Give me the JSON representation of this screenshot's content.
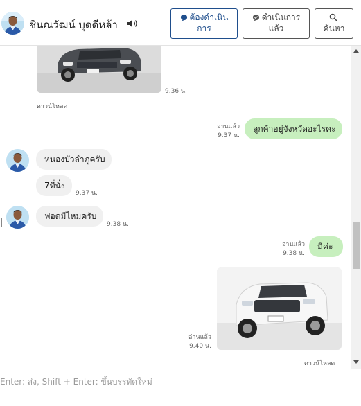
{
  "header": {
    "contact_name": "ชินณวัฒน์ บุดดีหล้า",
    "buttons": {
      "pending": {
        "line1": "ต้องดำเนิน",
        "line2": "การ"
      },
      "done": {
        "line1": "ดำเนินการ",
        "line2": "แล้ว"
      },
      "search": {
        "line1": "ค้นหา"
      }
    },
    "icons": [
      "avatar",
      "speaker-icon",
      "chat-bubble-icon",
      "check-bubble-icon",
      "search-icon"
    ]
  },
  "messages": {
    "m1": {
      "time": "9.36 น.",
      "download": "ดาวน์โหลด"
    },
    "m2": {
      "text": "ลูกค้าอยู่จังหวัดอะไรคะ",
      "read": "อ่านแล้ว",
      "time": "9.37 น."
    },
    "m3": {
      "text": "หนองบัวลำภูครับ"
    },
    "m4": {
      "text": "7ที่นั่ง",
      "time": "9.37 น."
    },
    "m5": {
      "text": "ฟอดมีไหมครับ",
      "time": "9.38 น."
    },
    "m6": {
      "text": "มีค่ะ",
      "read": "อ่านแล้ว",
      "time": "9.38 น."
    },
    "m7": {
      "read": "อ่านแล้ว",
      "time": "9.40 น.",
      "download": "ดาวน์โหลด"
    }
  },
  "composer": {
    "placeholder": "Enter: ส่ง, Shift + Enter: ขึ้นบรรทัดใหม่"
  },
  "colors": {
    "outgoing_bubble": "#c7efbe",
    "incoming_bubble": "#f0f0f0",
    "button_accent": "#1f4e8c"
  }
}
